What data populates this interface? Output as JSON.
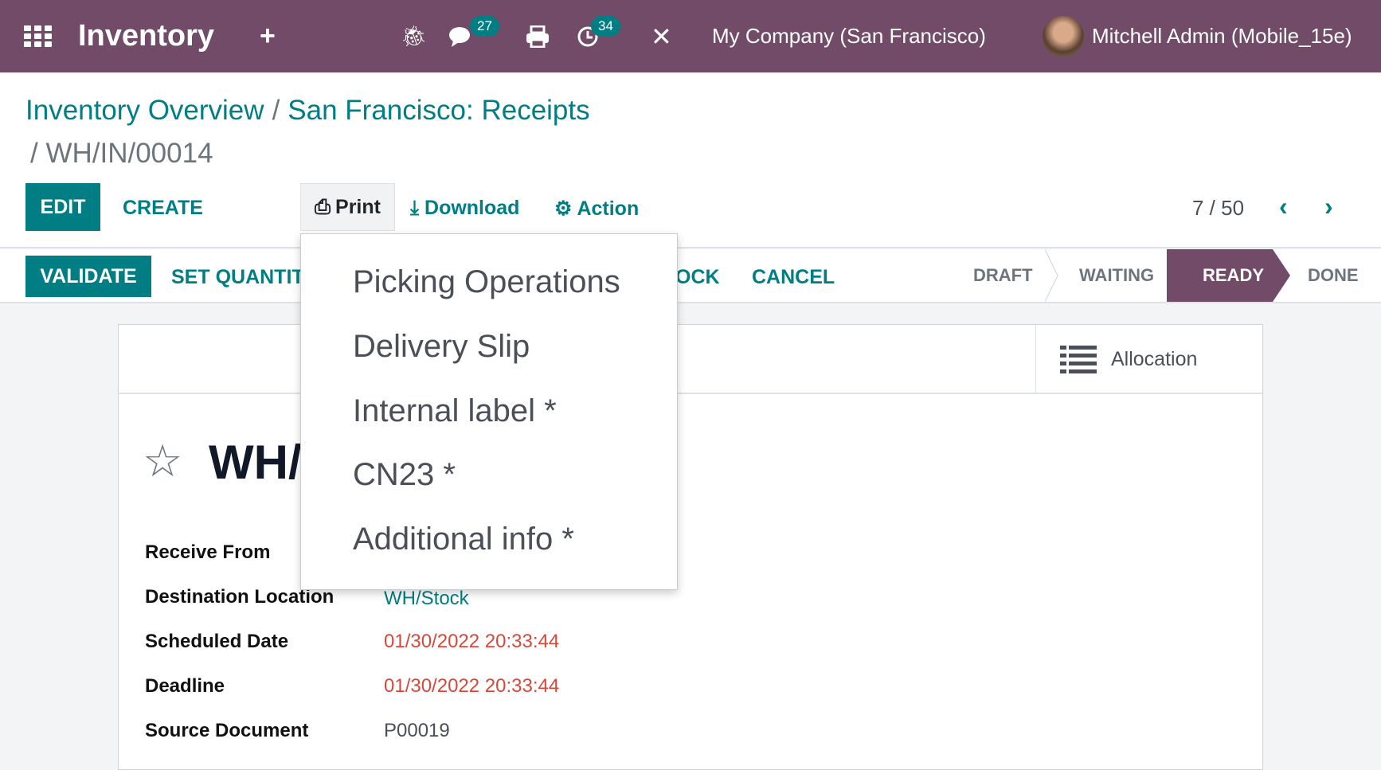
{
  "navbar": {
    "app_title": "Inventory",
    "messages_count": "27",
    "activities_count": "34",
    "company": "My Company (San Francisco)",
    "user": "Mitchell Admin (Mobile_15e)",
    "color": "#714b67"
  },
  "breadcrumb": {
    "items": [
      "Inventory Overview",
      "San Francisco: Receipts"
    ],
    "separator": "/",
    "current": "/ WH/IN/00014"
  },
  "toolbar": {
    "edit": "EDIT",
    "create": "CREATE",
    "print": "Print",
    "download": "Download",
    "action": "Action",
    "pager": "7 / 50"
  },
  "statusbar": {
    "validate": "VALIDATE",
    "set_quantities": "SET QUANTIT",
    "unlock_partial": "OCK",
    "cancel": "CANCEL",
    "stages": [
      "DRAFT",
      "WAITING",
      "READY",
      "DONE"
    ],
    "active_stage": "READY"
  },
  "print_menu": {
    "items": [
      "Picking Operations",
      "Delivery Slip",
      "Internal label *",
      "CN23 *",
      "Additional info *"
    ]
  },
  "sheet": {
    "allocation": "Allocation",
    "title": "WH/",
    "fields": [
      {
        "label": "Receive From",
        "value": ""
      },
      {
        "label": "Destination Location",
        "value": "WH/Stock"
      },
      {
        "label": "Scheduled Date",
        "value": "01/30/2022 20:33:44"
      },
      {
        "label": "Deadline",
        "value": "01/30/2022 20:33:44"
      },
      {
        "label": "Source Document",
        "value": "P00019"
      }
    ]
  },
  "colors": {
    "accent": "#017e84",
    "danger": "#d9473b"
  }
}
